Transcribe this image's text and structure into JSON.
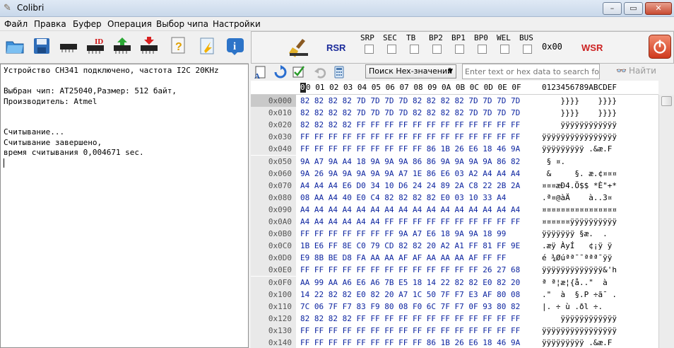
{
  "window": {
    "title": "Colibri",
    "minimize": "–",
    "maximize": "▭",
    "close": "✕"
  },
  "menu": [
    "Файл",
    "Правка",
    "Буфер",
    "Операция",
    "Выбор чипа",
    "Настройки"
  ],
  "toolbar": {
    "id_label": "ID"
  },
  "registers": {
    "rsr": "RSR",
    "bits": [
      "SRP",
      "SEC",
      "TB",
      "BP2",
      "BP1",
      "BP0",
      "WEL",
      "BUS"
    ],
    "value": "0x00",
    "wsr": "WSR"
  },
  "log": [
    "Устройство CH341 подключено, частота I2C 20KHz",
    "",
    "Выбран чип: AT25040,Размер: 512 байт,",
    "Производитель: Atmel",
    "",
    "",
    "Считывание...",
    "Считывание завершено,",
    "время считывания 0,004671 sec."
  ],
  "search": {
    "mode": "Поиск Hex-значений",
    "placeholder": "Enter text or hex data to search for:",
    "find": "Найти"
  },
  "hex": {
    "cursor": "0",
    "columns": "0 01 02 03 04 05 06 07 08 09 0A 0B 0C 0D 0E 0F",
    "ascii_header": "0123456789ABCDEF",
    "rows": [
      {
        "addr": "0x000",
        "bytes": "82 82 82 82 7D 7D 7D 7D 82 82 82 82 7D 7D 7D 7D",
        "ascii": "    }}}}    }}}}"
      },
      {
        "addr": "0x010",
        "bytes": "82 82 82 82 7D 7D 7D 7D 82 82 82 82 7D 7D 7D 7D",
        "ascii": "    }}}}    }}}}"
      },
      {
        "addr": "0x020",
        "bytes": "82 82 82 82 FF FF FF FF FF FF FF FF FF FF FF FF",
        "ascii": "    ÿÿÿÿÿÿÿÿÿÿÿÿ"
      },
      {
        "addr": "0x030",
        "bytes": "FF FF FF FF FF FF FF FF FF FF FF FF FF FF FF FF",
        "ascii": "ÿÿÿÿÿÿÿÿÿÿÿÿÿÿÿÿ"
      },
      {
        "addr": "0x040",
        "bytes": "FF FF FF FF FF FF FF FF FF 86 1B 26 E6 18 46 9A",
        "ascii": "ÿÿÿÿÿÿÿÿÿ .&æ.F "
      },
      {
        "addr": "0x050",
        "bytes": "9A A7 9A A4 18 9A 9A 9A 86 86 9A 9A 9A 9A 86 82",
        "ascii": " § ¤.          "
      },
      {
        "addr": "0x060",
        "bytes": "9A 26 9A 9A 9A 9A 9A A7 1E 86 E6 03 A2 A4 A4 A4",
        "ascii": " &     §. æ.¢¤¤¤"
      },
      {
        "addr": "0x070",
        "bytes": "A4 A4 A4 E6 D0 34 10 D6 24 24 89 2A C8 22 2B 2A",
        "ascii": "¤¤¤æÐ4.Ö$$ *È\"+*"
      },
      {
        "addr": "0x080",
        "bytes": "08 AA A4 40 E0 C4 82 82 82 82 E0 03 10 33 A4",
        "ascii": ".ª¤@àÄ    à..3¤"
      },
      {
        "addr": "0x090",
        "bytes": "A4 A4 A4 A4 A4 A4 A4 A4 A4 A4 A4 A4 A4 A4 A4 A4",
        "ascii": "¤¤¤¤¤¤¤¤¤¤¤¤¤¤¤¤"
      },
      {
        "addr": "0x0A0",
        "bytes": "A4 A4 A4 A4 A4 A4 FF FF FF FF FF FF FF FF FF FF",
        "ascii": "¤¤¤¤¤¤ÿÿÿÿÿÿÿÿÿÿ"
      },
      {
        "addr": "0x0B0",
        "bytes": "FF FF FF FF FF FF FF 9A A7 E6 18 9A 9A 18 99",
        "ascii": "ÿÿÿÿÿÿÿ §æ.  .  "
      },
      {
        "addr": "0x0C0",
        "bytes": "1B E6 FF 8E C0 79 CD 82 82 20 A2 A1 FF 81 FF 9E",
        "ascii": ".æÿ ÀyÍ   ¢¡ÿ ÿ "
      },
      {
        "addr": "0x0D0",
        "bytes": "E9 8B BE D8 FA AA AA AF AF AA AA AA AF FF FF",
        "ascii": "é ¾Øúªª¯¯ªªª¯ÿÿ"
      },
      {
        "addr": "0x0E0",
        "bytes": "FF FF FF FF FF FF FF FF FF FF FF FF FF 26 27 68",
        "ascii": "ÿÿÿÿÿÿÿÿÿÿÿÿÿ&'h"
      },
      {
        "addr": "0x0F0",
        "bytes": "AA 99 AA A6 E6 A6 7B E5 18 14 22 82 82 E0 82 20",
        "ascii": "ª ª¦æ¦{å..\"  à  "
      },
      {
        "addr": "0x100",
        "bytes": "14 22 82 82 E0 82 20 A7 1C 50 7F F7 E3 AF 80 08",
        "ascii": ".\"  à  §.P ÷ã¯ ."
      },
      {
        "addr": "0x110",
        "bytes": "7C 06 7F F7 83 F9 80 08 F0 6C 7F F7 0F 93 80 82",
        "ascii": "|. ÷ ù .ðl ÷.   "
      },
      {
        "addr": "0x120",
        "bytes": "82 82 82 82 FF FF FF FF FF FF FF FF FF FF FF FF",
        "ascii": "    ÿÿÿÿÿÿÿÿÿÿÿÿ"
      },
      {
        "addr": "0x130",
        "bytes": "FF FF FF FF FF FF FF FF FF FF FF FF FF FF FF FF",
        "ascii": "ÿÿÿÿÿÿÿÿÿÿÿÿÿÿÿÿ"
      },
      {
        "addr": "0x140",
        "bytes": "FF FF FF FF FF FF FF FF FF 86 1B 26 E6 18 46 9A",
        "ascii": "ÿÿÿÿÿÿÿÿÿ .&æ.F "
      }
    ]
  },
  "colors": {
    "rsr": "#1a2a9a",
    "wsr": "#cc2222",
    "bytes": "#0c24a0"
  }
}
